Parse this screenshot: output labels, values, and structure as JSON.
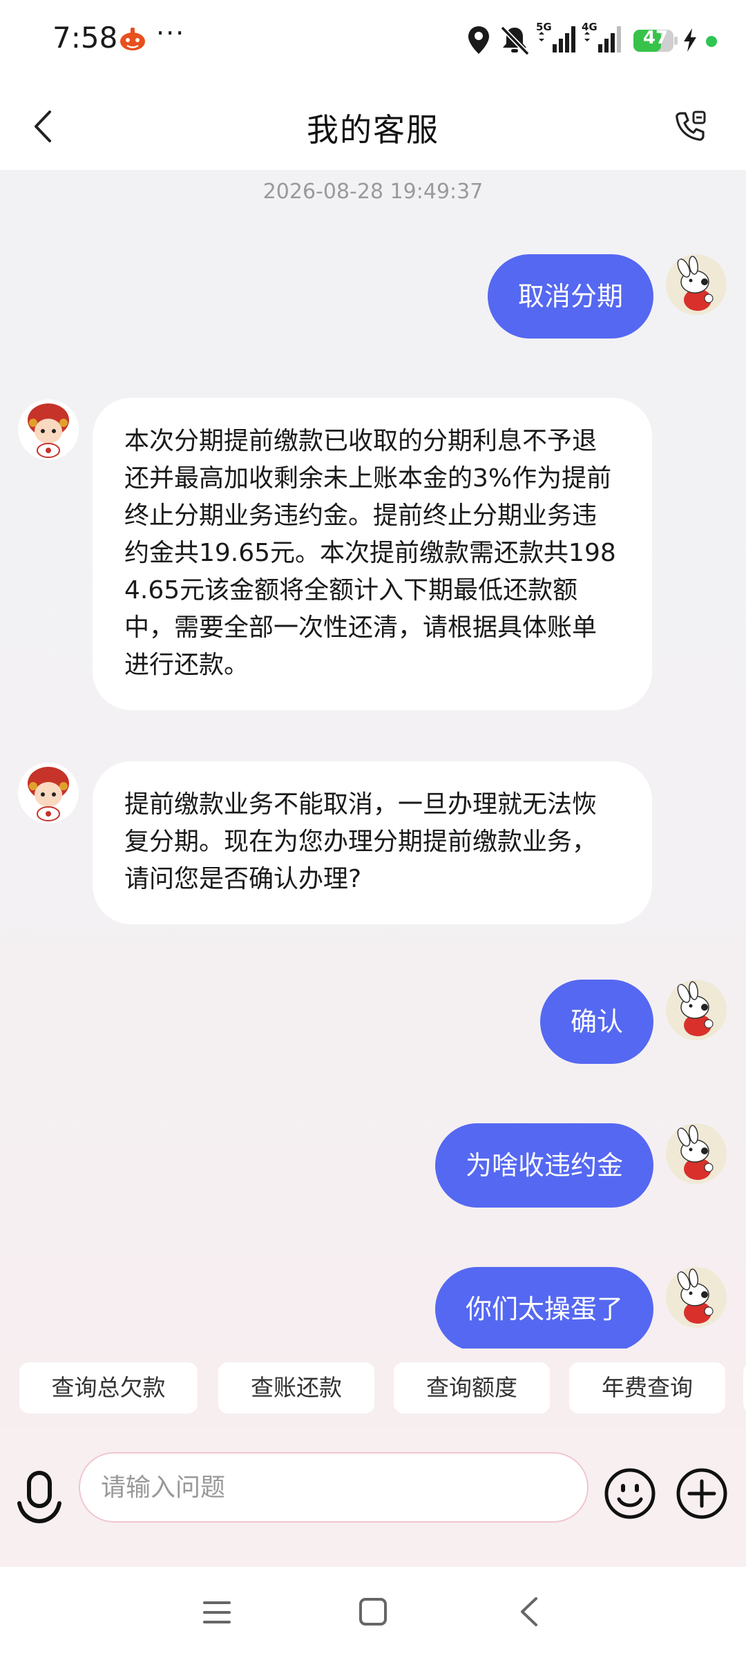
{
  "status_bar": {
    "time": "7:58",
    "more": "···",
    "network_5g": "5G",
    "network_4g": "4G",
    "battery": "47",
    "icons": [
      "app-notification-icon",
      "location-icon",
      "mute-icon",
      "signal-5g-icon",
      "signal-4g-icon",
      "battery-icon",
      "charging-icon"
    ]
  },
  "header": {
    "title": "我的客服",
    "back_icon": "back-arrow-icon",
    "call_icon": "phone-call-icon"
  },
  "chat": {
    "timestamp": "2026-08-28 19:49:37",
    "messages": [
      {
        "sender": "user",
        "text": "取消分期"
      },
      {
        "sender": "bot",
        "text": "本次分期提前缴款已收取的分期利息不予退还并最高加收剩余未上账本金的3%作为提前终止分期业务违约金。提前终止分期业务违约金共19.65元。本次提前缴款需还款共1984.65元该金额将全额计入下期最低还款额中，需要全部一次性还清，请根据具体账单进行还款。"
      },
      {
        "sender": "bot",
        "text": "提前缴款业务不能取消，一旦办理就无法恢复分期。现在为您办理分期提前缴款业务，请问您是否确认办理?"
      },
      {
        "sender": "user",
        "text": "确认"
      },
      {
        "sender": "user",
        "text": "为啥收违约金"
      },
      {
        "sender": "user",
        "text": "你们太操蛋了"
      }
    ]
  },
  "quick_replies": [
    "查询总欠款",
    "查账还款",
    "查询额度",
    "年费查询"
  ],
  "input": {
    "placeholder": "请输入问题",
    "value": ""
  },
  "colors": {
    "user_bubble": "#5568f1",
    "bot_bubble": "#ffffff",
    "background": "#f2f2f4"
  }
}
